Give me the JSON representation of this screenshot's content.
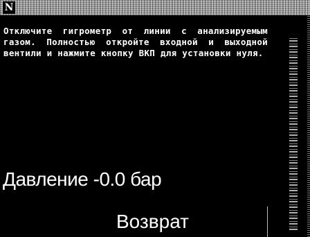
{
  "logo": {
    "text": "N"
  },
  "instructions": {
    "text": "Отключите гигрометр от линии с анализируемым газом. Полностью откройте входной и выходной вентили и нажмите кнопку ВКП для установки нуля."
  },
  "reading": {
    "label": "Давление -0.0 бар"
  },
  "buttons": {
    "back_label": "Возврат"
  }
}
